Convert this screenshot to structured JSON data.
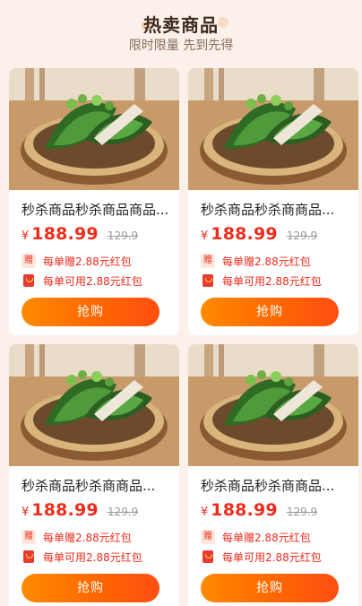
{
  "header": {
    "title": "热卖商品",
    "subtitle": "限时限量 先到先得"
  },
  "products": [
    {
      "name": "秒杀商品秒杀商品商品...",
      "currency": "¥",
      "price": "188.99",
      "original_price": "129.9",
      "gift_badge": "赠",
      "gift_text": "每单赠2.88元红包",
      "pack_text": "每单可用2.88元红包",
      "buy_label": "抢购"
    },
    {
      "name": "秒杀商品秒杀商商品...",
      "currency": "¥",
      "price": "188.99",
      "original_price": "129.9",
      "gift_badge": "赠",
      "gift_text": "每单赠2.88元红包",
      "pack_text": "每单可用2.88元红包",
      "buy_label": "抢购"
    },
    {
      "name": "秒杀商品秒杀商商品...",
      "currency": "¥",
      "price": "188.99",
      "original_price": "129.9",
      "gift_badge": "赠",
      "gift_text": "每单赠2.88元红包",
      "pack_text": "每单可用2.88元红包",
      "buy_label": "抢购"
    },
    {
      "name": "秒杀商品秒杀商商品...",
      "currency": "¥",
      "price": "188.99",
      "original_price": "129.9",
      "gift_badge": "赠",
      "gift_text": "每单赠2.88元红包",
      "pack_text": "每单可用2.88元红包",
      "buy_label": "抢购"
    }
  ],
  "colors": {
    "accent": "#ee2c1c",
    "button_start": "#ff8a00",
    "button_end": "#ff4e12",
    "background": "#fbf1ea"
  }
}
